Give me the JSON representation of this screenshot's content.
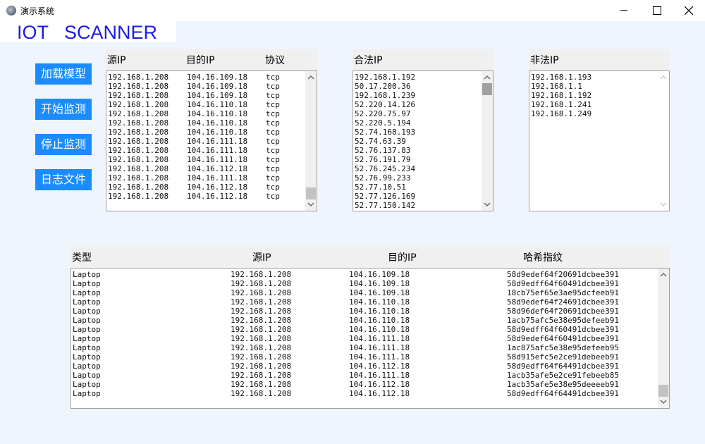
{
  "window": {
    "title": "演示系统"
  },
  "brand": {
    "text": "IOT   SCANNER"
  },
  "buttons": {
    "load_model": "加载模型",
    "start_monitor": "开始监测",
    "stop_monitor": "停止监测",
    "log_file": "日志文件"
  },
  "traffic": {
    "headers": {
      "src": "源IP",
      "dst": "目的IP",
      "proto": "协议"
    },
    "rows": [
      [
        "192.168.1.208",
        "104.16.109.18",
        "tcp"
      ],
      [
        "192.168.1.208",
        "104.16.109.18",
        "tcp"
      ],
      [
        "192.168.1.208",
        "104.16.109.18",
        "tcp"
      ],
      [
        "192.168.1.208",
        "104.16.110.18",
        "tcp"
      ],
      [
        "192.168.1.208",
        "104.16.110.18",
        "tcp"
      ],
      [
        "192.168.1.208",
        "104.16.110.18",
        "tcp"
      ],
      [
        "192.168.1.208",
        "104.16.110.18",
        "tcp"
      ],
      [
        "192.168.1.208",
        "104.16.111.18",
        "tcp"
      ],
      [
        "192.168.1.208",
        "104.16.111.18",
        "tcp"
      ],
      [
        "192.168.1.208",
        "104.16.111.18",
        "tcp"
      ],
      [
        "192.168.1.208",
        "104.16.112.18",
        "tcp"
      ],
      [
        "192.168.1.208",
        "104.16.111.18",
        "tcp"
      ],
      [
        "192.168.1.208",
        "104.16.112.18",
        "tcp"
      ],
      [
        "192.168.1.208",
        "104.16.112.18",
        "tcp"
      ]
    ]
  },
  "legal": {
    "header": "合法IP",
    "items": [
      "192.168.1.192",
      "50.17.200.36",
      "192.168.1.239",
      "52.220.14.126",
      "52.220.75.97",
      "52.220.5.194",
      "52.74.168.193",
      "52.74.63.39",
      "52.76.137.83",
      "52.76.191.79",
      "52.76.245.234",
      "52.76.99.233",
      "52.77.10.51",
      "52.77.126.169",
      "52.77.150.142"
    ]
  },
  "illegal": {
    "header": "非法IP",
    "items": [
      "192.168.1.193",
      "192.168.1.1",
      "192.168.1.192",
      "192.168.1.241",
      "192.168.1.249"
    ]
  },
  "log": {
    "headers": {
      "type": "类型",
      "src": "源IP",
      "dst": "目的IP",
      "hash": "哈希指纹"
    },
    "rows": [
      [
        "Laptop",
        "192.168.1.208",
        "104.16.109.18",
        "58d9edef64f20691dcbee391"
      ],
      [
        "Laptop",
        "192.168.1.208",
        "104.16.109.18",
        "58d9edff64f60491dcbee391"
      ],
      [
        "Laptop",
        "192.168.1.208",
        "104.16.109.18",
        "18cb75ef65e3ae95dcfeeb91"
      ],
      [
        "Laptop",
        "192.168.1.208",
        "104.16.110.18",
        "58d9edef64f24691dcbee391"
      ],
      [
        "Laptop",
        "192.168.1.208",
        "104.16.110.18",
        "58d96def64f20691dcbee391"
      ],
      [
        "Laptop",
        "192.168.1.208",
        "104.16.110.18",
        "1acb75afc5e38e95defeeb91"
      ],
      [
        "Laptop",
        "192.168.1.208",
        "104.16.110.18",
        "58d9edff64f60491dcbee391"
      ],
      [
        "Laptop",
        "192.168.1.208",
        "104.16.111.18",
        "58d9edef64f60491dcbee391"
      ],
      [
        "Laptop",
        "192.168.1.208",
        "104.16.111.18",
        "1ac875afc5e38e95defeeb95"
      ],
      [
        "Laptop",
        "192.168.1.208",
        "104.16.111.18",
        "58d915efc5e2ce91debeeb91"
      ],
      [
        "Laptop",
        "192.168.1.208",
        "104.16.112.18",
        "58d9edff64f64491dcbee391"
      ],
      [
        "Laptop",
        "192.168.1.208",
        "104.16.111.18",
        "1acb35afe5e2ce91febeeb85"
      ],
      [
        "Laptop",
        "192.168.1.208",
        "104.16.112.18",
        "1acb35afe5e38e95deeeeb91"
      ],
      [
        "Laptop",
        "192.168.1.208",
        "104.16.112.18",
        "58d9edff64f64491dcbee391"
      ]
    ]
  }
}
